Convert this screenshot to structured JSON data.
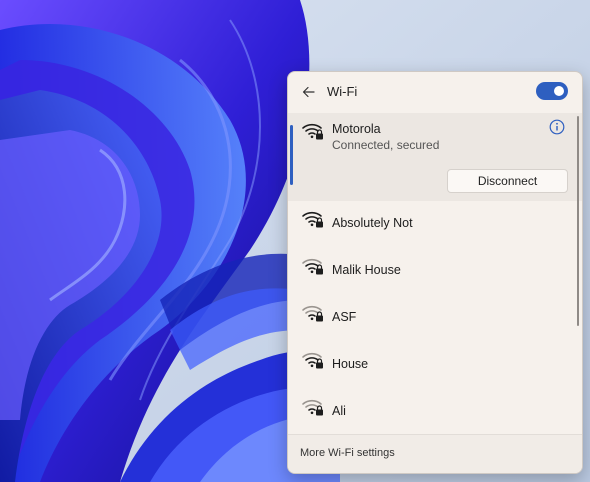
{
  "panel": {
    "title": "Wi-Fi",
    "wifi_enabled": true,
    "accent_color": "#2e5fc0"
  },
  "connected_network": {
    "name": "Motorola",
    "status": "Connected, secured",
    "disconnect_label": "Disconnect",
    "info_icon": "info-icon"
  },
  "networks": [
    {
      "name": "Absolutely Not",
      "icon": "wifi-secured-icon"
    },
    {
      "name": "Malik House",
      "icon": "wifi-secured-icon"
    },
    {
      "name": "ASF",
      "icon": "wifi-secured-icon"
    },
    {
      "name": "House",
      "icon": "wifi-secured-icon"
    },
    {
      "name": "Ali",
      "icon": "wifi-secured-icon"
    }
  ],
  "footer": {
    "link": "More Wi-Fi settings"
  }
}
